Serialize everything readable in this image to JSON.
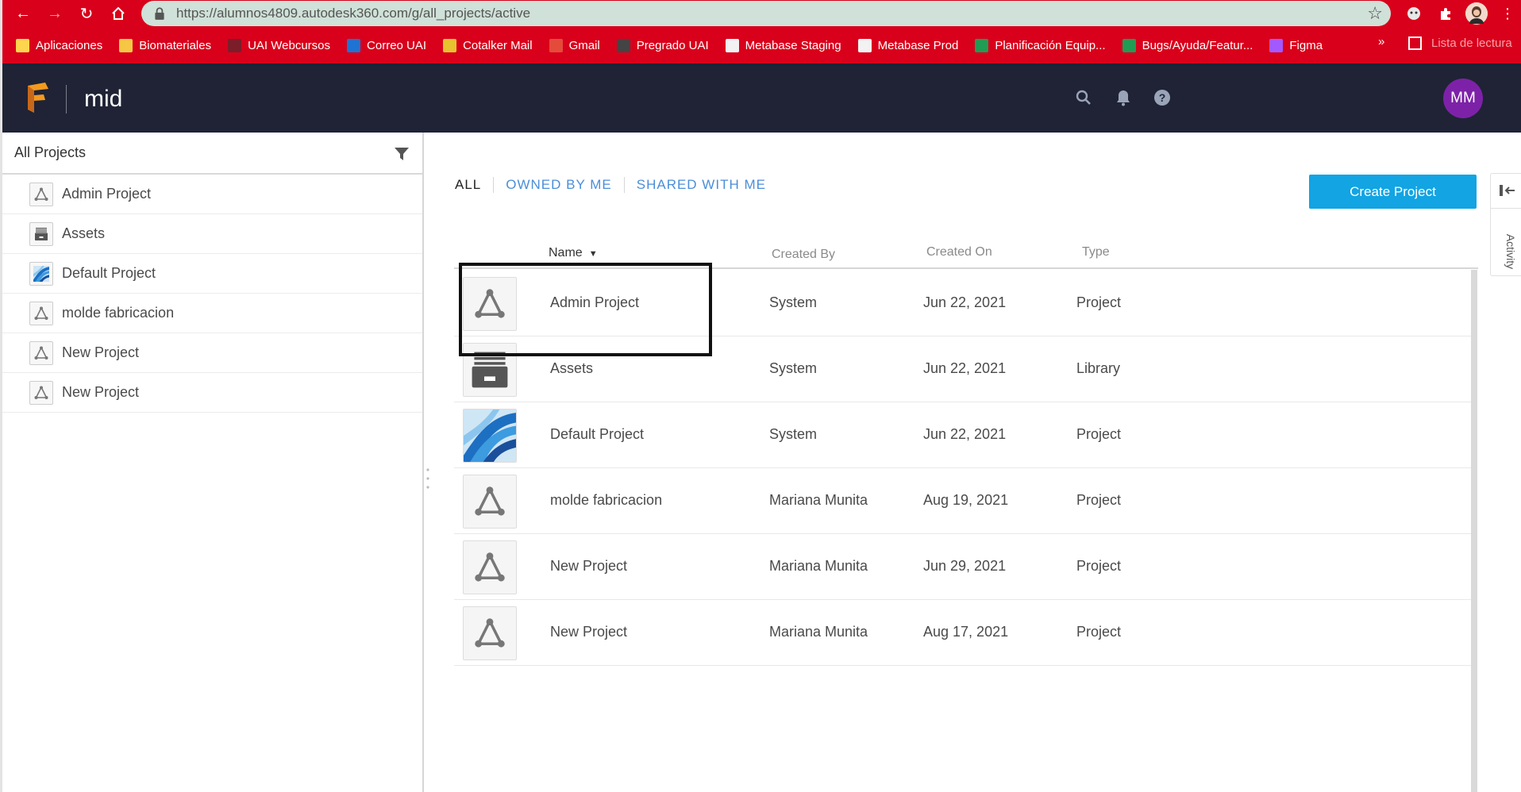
{
  "browser": {
    "url": "https://alumnos4809.autodesk360.com/g/all_projects/active",
    "bookmarks": [
      {
        "label": "Aplicaciones",
        "color": "#ffd54f"
      },
      {
        "label": "Biomateriales",
        "color": "#f6c744"
      },
      {
        "label": "UAI Webcursos",
        "color": "#7b1e2a"
      },
      {
        "label": "Correo UAI",
        "color": "#1e74d2"
      },
      {
        "label": "Cotalker Mail",
        "color": "#e8c12f"
      },
      {
        "label": "Gmail",
        "color": "#e44b3a"
      },
      {
        "label": "Pregrado UAI",
        "color": "#444444"
      },
      {
        "label": "Metabase Staging",
        "color": "#f2f2f2"
      },
      {
        "label": "Metabase Prod",
        "color": "#f2f2f2"
      },
      {
        "label": "Planificación Equip...",
        "color": "#1f9d55"
      },
      {
        "label": "Bugs/Ayuda/Featur...",
        "color": "#1f9d55"
      },
      {
        "label": "Figma",
        "color": "#a259ff"
      }
    ],
    "more": "»",
    "reading_list": "Lista de lectura"
  },
  "header": {
    "hub_name": "mid",
    "avatar_initials": "MM",
    "icons": [
      "search-icon",
      "bell-icon",
      "help-icon"
    ]
  },
  "sidebar": {
    "title": "All Projects",
    "items": [
      {
        "label": "Admin Project",
        "icon": "project-icon"
      },
      {
        "label": "Assets",
        "icon": "library-icon"
      },
      {
        "label": "Default Project",
        "icon": "default-project-thumbnail"
      },
      {
        "label": "molde fabricacion",
        "icon": "project-icon"
      },
      {
        "label": "New Project",
        "icon": "project-icon"
      },
      {
        "label": "New Project",
        "icon": "project-icon"
      }
    ]
  },
  "main": {
    "tabs": [
      "ALL",
      "OWNED BY ME",
      "SHARED WITH ME"
    ],
    "create_button": "Create Project",
    "columns": {
      "name": "Name",
      "created_by": "Created By",
      "created_on": "Created On",
      "type": "Type"
    },
    "rows": [
      {
        "name": "Admin Project",
        "created_by": "System",
        "created_on": "Jun 22, 2021",
        "type": "Project",
        "thumb": "project"
      },
      {
        "name": "Assets",
        "created_by": "System",
        "created_on": "Jun 22, 2021",
        "type": "Library",
        "thumb": "library"
      },
      {
        "name": "Default Project",
        "created_by": "System",
        "created_on": "Jun 22, 2021",
        "type": "Project",
        "thumb": "default"
      },
      {
        "name": "molde fabricacion",
        "created_by": "Mariana Munita",
        "created_on": "Aug 19, 2021",
        "type": "Project",
        "thumb": "project"
      },
      {
        "name": "New Project",
        "created_by": "Mariana Munita",
        "created_on": "Jun 29, 2021",
        "type": "Project",
        "thumb": "project"
      },
      {
        "name": "New Project",
        "created_by": "Mariana Munita",
        "created_on": "Aug 17, 2021",
        "type": "Project",
        "thumb": "project"
      }
    ]
  },
  "activity": {
    "label": "Activity"
  },
  "colors": {
    "browser_red": "#d9001b",
    "header_navy": "#1f2335",
    "accent_blue": "#12a4e3",
    "link_blue": "#4a8ed8",
    "avatar_purple": "#7d22a8"
  }
}
